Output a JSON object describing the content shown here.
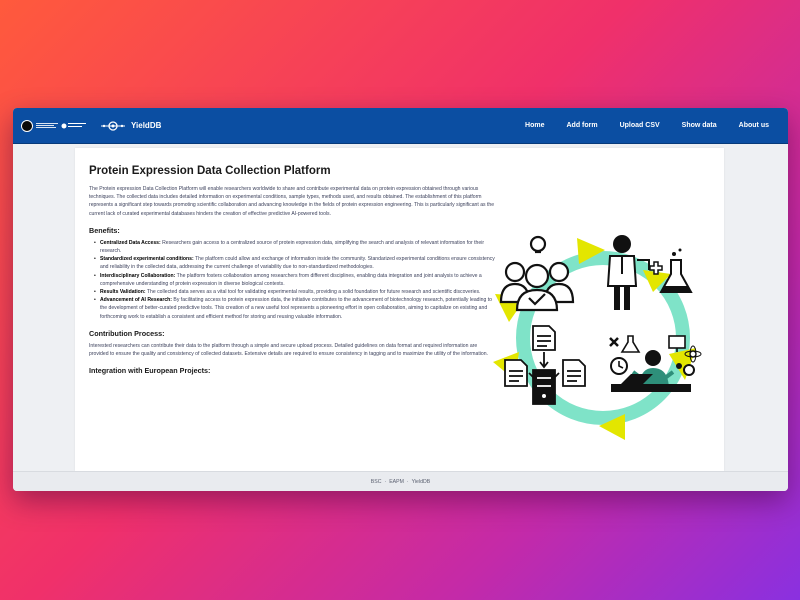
{
  "nav": {
    "brand": "YieldDB",
    "links": [
      "Home",
      "Add form",
      "Upload CSV",
      "Show data",
      "About us"
    ]
  },
  "page": {
    "title": "Protein Expression Data Collection Platform",
    "intro": "The Protein expression Data Collection Platform will enable researchers worldwide to share and contribute experimental data on protein expression obtained through various techniques. The collected data includes detailed information on experimental conditions, sample types, methods used, and results obtained. The establishment of this platform represents a significant step towards promoting scientific collaboration and advancing knowledge in the fields of protein expression engineering. This is particularly significant as the current lack of curated experimental databases hinders the creation of effective predictive AI-powered tools.",
    "benefits_heading": "Benefits:",
    "benefits": [
      {
        "term": "Centralized Data Access:",
        "text": " Researchers gain access to a centralized source of protein expression data, simplifying the search and analysis of relevant information for their research."
      },
      {
        "term": "Standardized experimental conditions:",
        "text": " The platform could allow and exchange of information inside the community. Standarized experimental conditions ensure consistency and reliability in the collected data, addressing the current challenge of variability due to non-standardized methodologies."
      },
      {
        "term": "Interdisciplinary Collaboration:",
        "text": " The platform fosters collaboration among researchers from different disciplines, enabling data integration and joint analysis to achieve a comprehensive understanding of protein expression in diverse biological contexts."
      },
      {
        "term": "Results Validation:",
        "text": " The collected data serves as a vital tool for validating experimental results, providing a solid foundation for future research and scientific discoveries."
      },
      {
        "term": "Advancement of AI Research:",
        "text": " By facilitating access to protein expression data, the initiative contributes to the advancement of biotechnology research, potentially leading to the development of better-curated predictive tools. This creation of a new useful tool represents a pioneering effort in open collaboration, aiming to capitalize on existing and forthcoming work to establish a consistent and efficient method for storing and reusing valuable information."
      }
    ],
    "contribution_heading": "Contribution Process:",
    "contribution_text": "Interested researchers can contribute their data to the platform through a simple and secure upload process. Detailed guidelines on data format and required information are provided to ensure the quality and consistency of collected datasets. Extensive details are required to ensure consistency in tagging and to maximize the utility of the information.",
    "integration_heading": "Integration with European Projects:"
  },
  "footer": {
    "items": [
      "BSC",
      "EAPM",
      "YieldDB"
    ],
    "separator": "·"
  },
  "colors": {
    "navbar": "#0b4ea2",
    "cycle_ring": "#7fe3c8",
    "cycle_arrows": "#e3e600"
  }
}
